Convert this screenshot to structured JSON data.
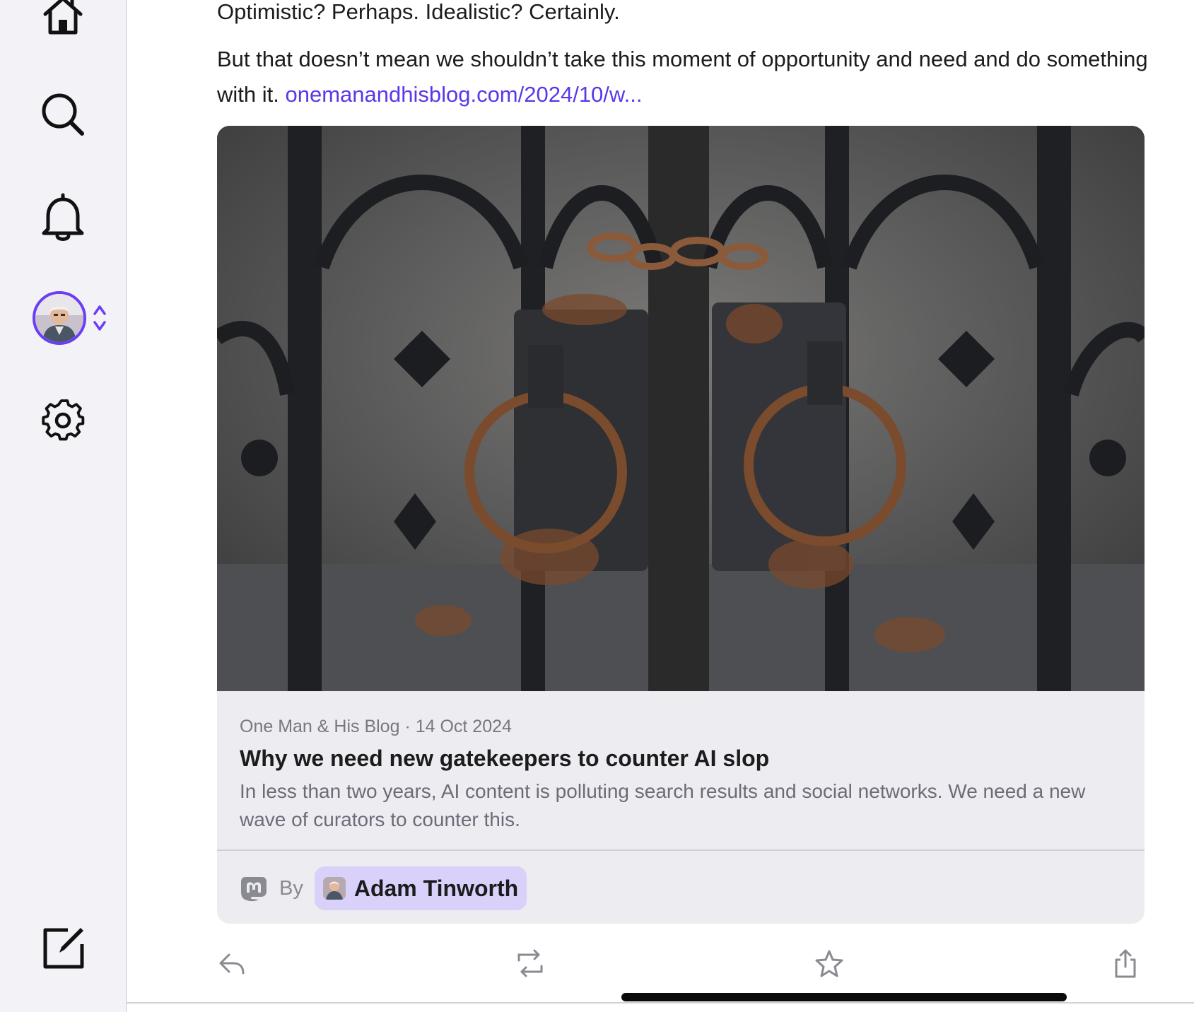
{
  "post": {
    "para1": "Optimistic? Perhaps. Idealistic? Certainly.",
    "para2_text": "But that doesn’t mean we shouldn’t take this moment of opportunity and need and do something with it. ",
    "para2_link": "onemanandhisblog.com/2024/10/w..."
  },
  "link_card": {
    "source": "One Man & His Blog",
    "separator": " · ",
    "date": "14 Oct 2024",
    "title": "Why we need new gatekeepers to counter AI slop",
    "description": "In less than two years, AI content is polluting search results and social networks. We need a new wave of curators to counter this.",
    "by_label": "By",
    "author_name": "Adam Tinworth",
    "image_alt": "Rusted wrought iron gate with two ring handles and a chain"
  },
  "sidebar": {
    "items": [
      "home-icon",
      "search-icon",
      "bell-icon",
      "avatar",
      "gear-icon",
      "compose-icon"
    ]
  },
  "actions": [
    "reply-icon",
    "boost-icon",
    "favorite-icon",
    "share-icon"
  ],
  "colors": {
    "accent": "#6b3df5",
    "link": "#5b37e8",
    "chip": "#d9d1fa",
    "card_bg": "#ececf1"
  }
}
